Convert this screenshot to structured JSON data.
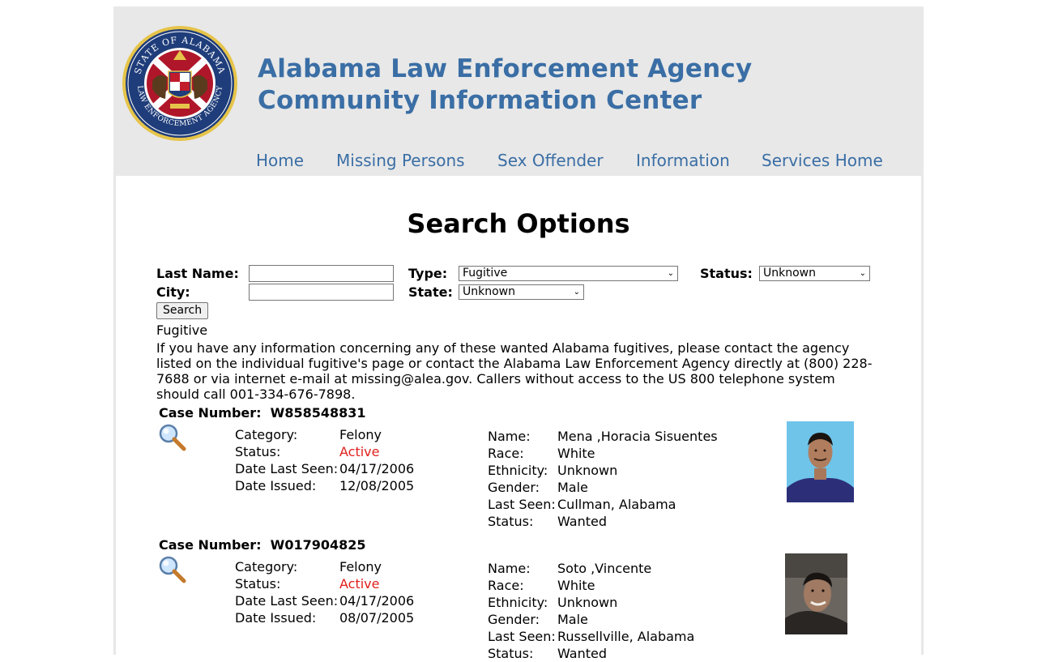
{
  "header": {
    "seal_text": "STATE OF ALABAMA · LAW ENFORCEMENT AGENCY",
    "title_line1": "Alabama Law Enforcement Agency",
    "title_line2": "Community Information Center"
  },
  "nav": [
    {
      "label": "Home"
    },
    {
      "label": "Missing Persons"
    },
    {
      "label": "Sex Offender"
    },
    {
      "label": "Information"
    },
    {
      "label": "Services Home"
    }
  ],
  "search": {
    "heading": "Search Options",
    "last_name_label": "Last Name:",
    "last_name_value": "",
    "city_label": "City:",
    "city_value": "",
    "type_label": "Type:",
    "type_value": "Fugitive",
    "state_label": "State:",
    "state_value": "Unknown",
    "status_label": "Status:",
    "status_value": "Unknown",
    "search_button": "Search"
  },
  "results": {
    "category_title": "Fugitive",
    "intro": "If you have any information concerning any of these wanted Alabama fugitives, please contact the agency listed on the individual fugitive's page or contact the Alabama Law Enforcement Agency directly at (800) 228-7688 or via internet e-mail at missing@alea.gov. Callers without access to the US 800 telephone system should call 001-334-676-7898.",
    "labels": {
      "case_number": "Case Number:",
      "category": "Category:",
      "status": "Status:",
      "date_last_seen": "Date Last Seen:",
      "date_issued": "Date Issued:",
      "name": "Name:",
      "race": "Race:",
      "ethnicity": "Ethnicity:",
      "gender": "Gender:",
      "last_seen": "Last Seen:",
      "person_status": "Status:"
    },
    "cases": [
      {
        "case_number": "W858548831",
        "category": "Felony",
        "status": "Active",
        "date_last_seen": "04/17/2006",
        "date_issued": "12/08/2005",
        "name": "Mena ,Horacia Sisuentes",
        "race": "White",
        "ethnicity": "Unknown",
        "gender": "Male",
        "last_seen": "Cullman, Alabama",
        "person_status": "Wanted"
      },
      {
        "case_number": "W017904825",
        "category": "Felony",
        "status": "Active",
        "date_last_seen": "04/17/2006",
        "date_issued": "08/07/2005",
        "name": "Soto ,Vincente",
        "race": "White",
        "ethnicity": "Unknown",
        "gender": "Male",
        "last_seen": "Russellville, Alabama",
        "person_status": "Wanted"
      }
    ]
  },
  "colors": {
    "brand_blue": "#3a6ea5",
    "active_red": "#e0201d",
    "header_gray": "#e8e8e8"
  }
}
